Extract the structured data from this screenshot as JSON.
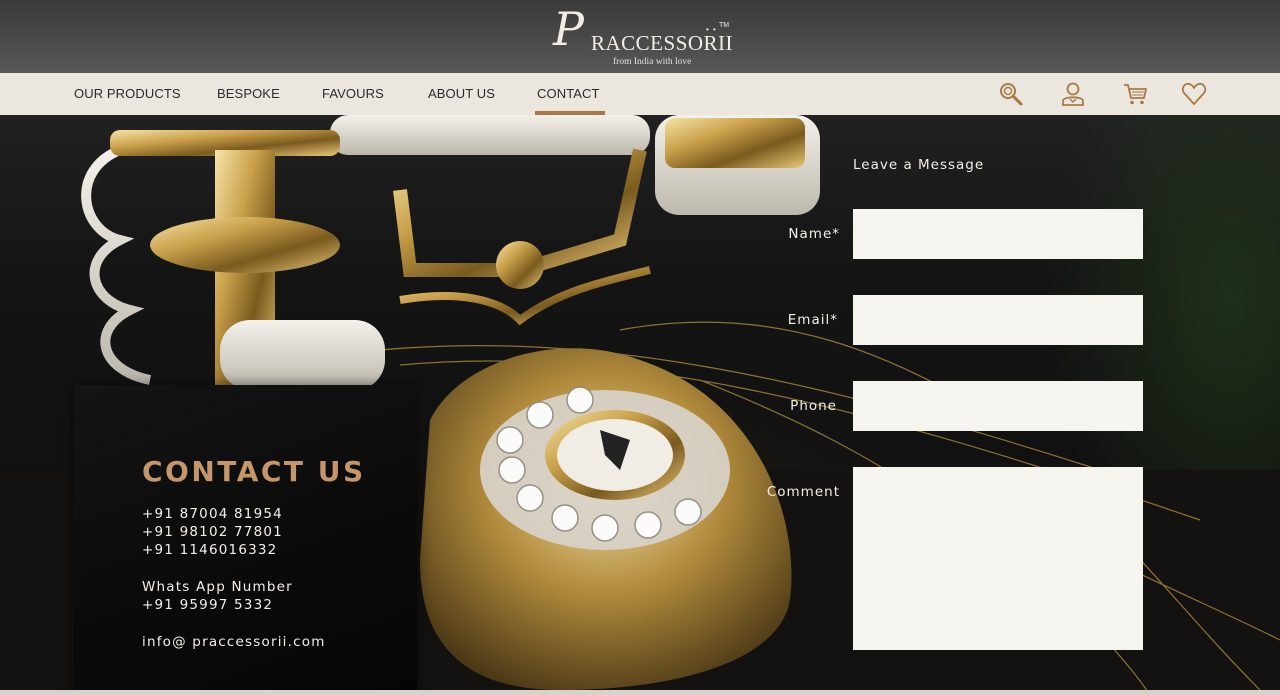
{
  "brand": {
    "logo_initial": "P",
    "logo_word": "RACCESSORII",
    "logo_dots": "• •",
    "trademark": "TM",
    "tagline": "from India with love"
  },
  "nav": {
    "items": [
      {
        "label": "OUR PRODUCTS"
      },
      {
        "label": "BESPOKE"
      },
      {
        "label": "FAVOURS"
      },
      {
        "label": "ABOUT US"
      },
      {
        "label": "CONTACT",
        "active": true
      }
    ],
    "icons": [
      "search-icon",
      "account-icon",
      "cart-icon",
      "wishlist-heart-icon"
    ],
    "accent_color": "#a97945"
  },
  "contact": {
    "heading": "CONTACT US",
    "phones": [
      "+91 87004 81954",
      "+91 98102 77801",
      "+91 1146016332"
    ],
    "whatsapp_label": "Whats App Number",
    "whatsapp_number": "+91 95997 5332",
    "email": "info@ praccessorii.com",
    "heading_color": "#c5966a"
  },
  "form": {
    "title": "Leave a Message",
    "name_label": "Name*",
    "name_value": "",
    "email_label": "Email*",
    "email_value": "",
    "phone_label": "Phone",
    "phone_value": "",
    "comment_label": "Comment",
    "comment_value": ""
  }
}
